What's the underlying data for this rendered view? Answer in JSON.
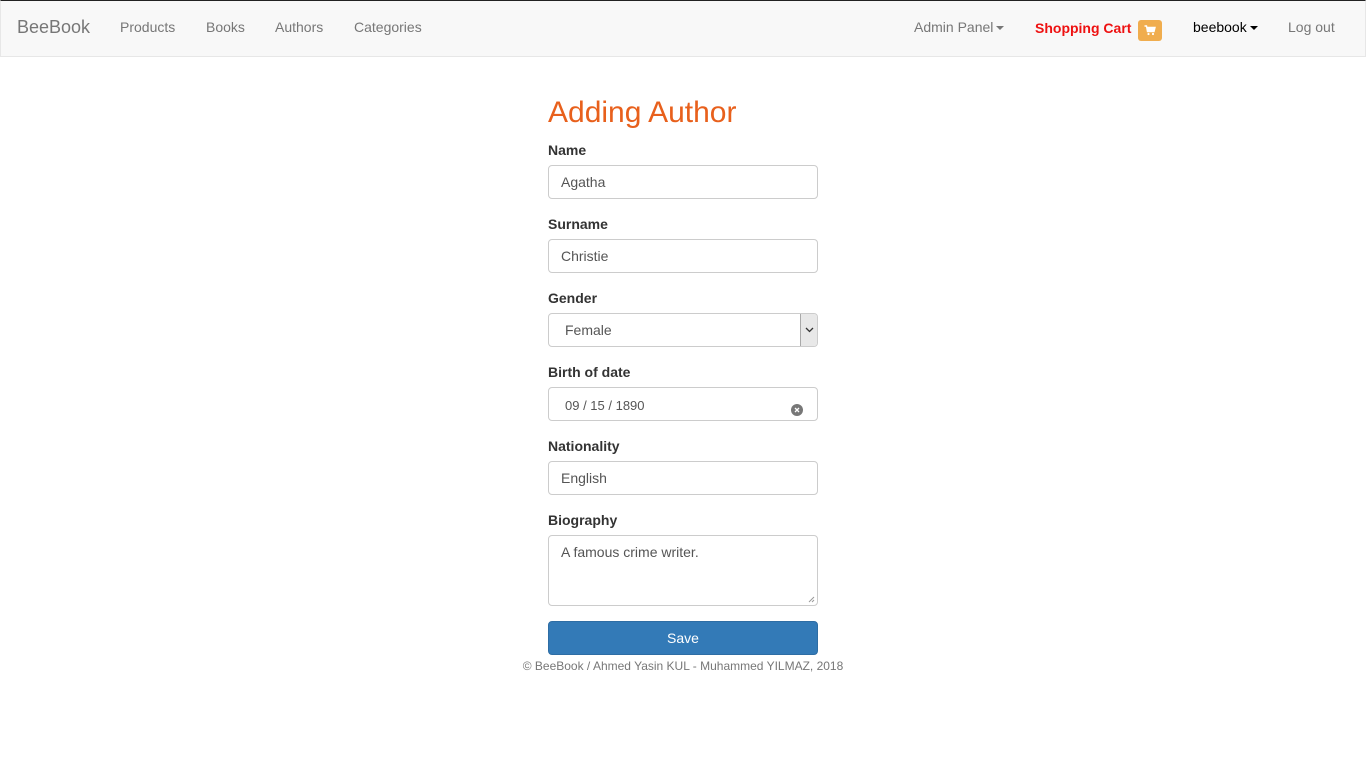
{
  "navbar": {
    "brand": "BeeBook",
    "links": [
      "Products",
      "Books",
      "Authors",
      "Categories"
    ],
    "admin_panel": "Admin Panel",
    "cart_label": "Shopping Cart",
    "cart_icon": "shopping-cart-icon",
    "user": "beebook",
    "logout": "Log out"
  },
  "form": {
    "title": "Adding Author",
    "name_label": "Name",
    "name_value": "Agatha",
    "surname_label": "Surname",
    "surname_value": "Christie",
    "gender_label": "Gender",
    "gender_value": "Female",
    "birth_label": "Birth of date",
    "birth_value": "09 / 15 / 1890",
    "nationality_label": "Nationality",
    "nationality_value": "English",
    "biography_label": "Biography",
    "biography_value": "A famous crime writer.",
    "save_label": "Save"
  },
  "footer": {
    "text": "© BeeBook / Ahmed Yasin KUL - Muhammed YILMAZ, 2018"
  },
  "colors": {
    "title": "#e8601c",
    "cart": "#ee1111",
    "cart_badge": "#f0ad4e",
    "primary": "#337ab7"
  }
}
